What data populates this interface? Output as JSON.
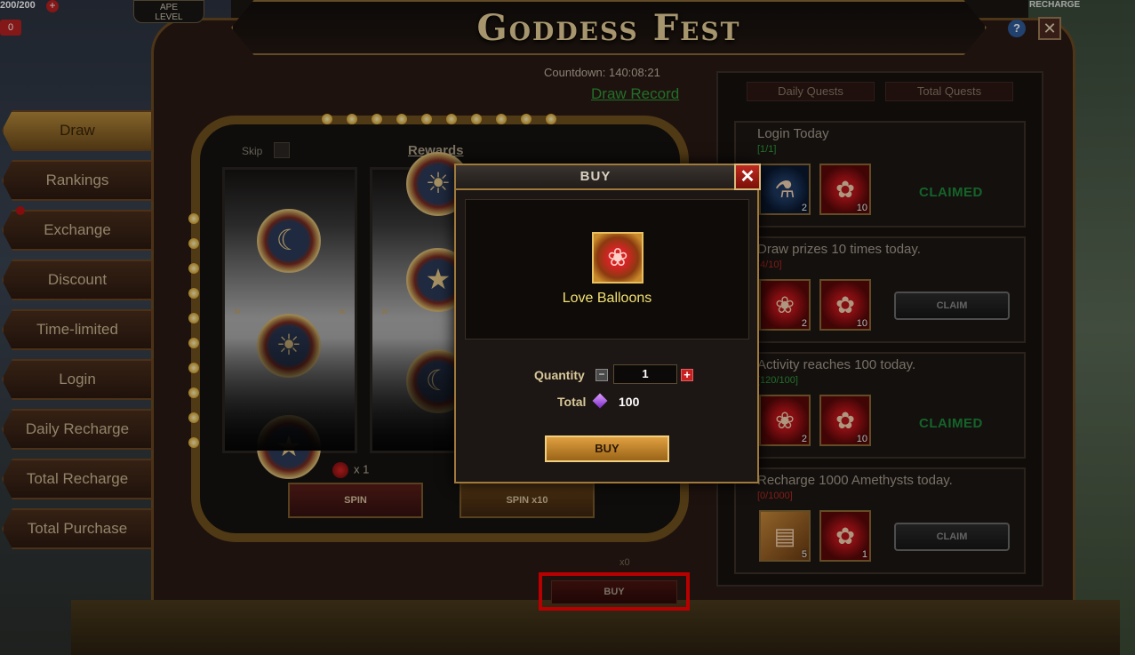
{
  "header": {
    "title": "Goddess Fest",
    "stamina": "200/200",
    "stamina_plus": "+",
    "left_chip": "0",
    "ape_level": "APE\nLEVEL",
    "recharge": "RECHARGE",
    "help": "?",
    "close": "✕"
  },
  "event": {
    "countdown": "Countdown: 140:08:21",
    "draw_record": "Draw Record"
  },
  "sidebar": {
    "items": [
      {
        "label": "Draw",
        "active": true
      },
      {
        "label": "Rankings"
      },
      {
        "label": "Exchange"
      },
      {
        "label": "Discount"
      },
      {
        "label": "Time-limited"
      },
      {
        "label": "Login"
      },
      {
        "label": "Daily Recharge"
      },
      {
        "label": "Total Recharge"
      },
      {
        "label": "Total Purchase"
      }
    ]
  },
  "slot": {
    "skip_label": "Skip",
    "rewards_label": "Rewards",
    "rose_count": "x 1",
    "spin_label": "SPIN",
    "spin10_label": "SPIN x10"
  },
  "quests": {
    "tabs": [
      "Daily Quests",
      "Total Quests"
    ],
    "cards": [
      {
        "title": "Login Today",
        "progress": "[1/1]",
        "progress_color": "#2f9a3a",
        "items": [
          {
            "type": "potion",
            "count": "2"
          },
          {
            "type": "rose-gift",
            "count": "10"
          }
        ],
        "status": "CLAIMED"
      },
      {
        "title": "Draw prizes 10 times today.",
        "progress": "[4/10]",
        "progress_color": "#b02a20",
        "items": [
          {
            "type": "rose",
            "count": "2"
          },
          {
            "type": "rose-gift",
            "count": "10"
          }
        ],
        "status": "CLAIM"
      },
      {
        "title": "Activity reaches 100 today.",
        "progress": "[120/100]",
        "progress_color": "#2f9a3a",
        "items": [
          {
            "type": "rose",
            "count": "2"
          },
          {
            "type": "rose-gift",
            "count": "10"
          }
        ],
        "status": "CLAIMED"
      },
      {
        "title": "Recharge 1000 Amethysts today.",
        "progress": "[0/1000]",
        "progress_color": "#b02a20",
        "items": [
          {
            "type": "card",
            "count": "5"
          },
          {
            "type": "rose-gift",
            "count": "1"
          }
        ],
        "status": "CLAIM"
      }
    ]
  },
  "bottom": {
    "x0": "x0",
    "buy_label": "BUY"
  },
  "modal": {
    "title": "BUY",
    "close": "✕",
    "item_name": "Love Balloons",
    "quantity_label": "Quantity",
    "quantity_value": "1",
    "minus": "−",
    "plus": "+",
    "total_label": "Total",
    "total_value": "100",
    "buy_label": "BUY"
  },
  "colors": {
    "accent_gold": "#a07a3a",
    "claimed_green": "#1d8a3a",
    "highlight_red": "#ff0000"
  }
}
